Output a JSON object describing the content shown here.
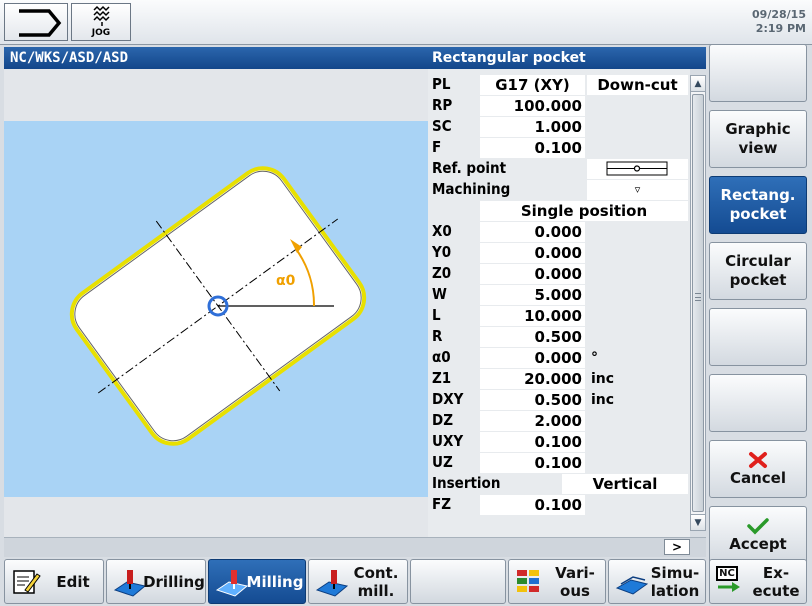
{
  "topbar": {
    "mode_label": "JOG",
    "date": "09/28/15",
    "time": "2:19 PM"
  },
  "path": "NC/WKS/ASD/ASD",
  "dialog_title": "Rectangular pocket",
  "graphic": {
    "angle_label": "α0",
    "colors": {
      "background": "#a9d3f5",
      "pocket_outline": "#e8e000",
      "origin": "#2f6fd8",
      "angle_arc": "#f0a000"
    }
  },
  "params": {
    "pl": {
      "label": "PL",
      "value": "G17 (XY)",
      "option": "Down-cut"
    },
    "rp": {
      "label": "RP",
      "value": "100.000"
    },
    "sc": {
      "label": "SC",
      "value": "1.000"
    },
    "f": {
      "label": "F",
      "value": "0.100"
    },
    "ref_point": {
      "label": "Ref. point"
    },
    "machining": {
      "label": "Machining",
      "value": "▿"
    },
    "position_mode": "Single position",
    "x0": {
      "label": "X0",
      "value": "0.000"
    },
    "y0": {
      "label": "Y0",
      "value": "0.000"
    },
    "z0": {
      "label": "Z0",
      "value": "0.000"
    },
    "w": {
      "label": "W",
      "value": "5.000"
    },
    "l": {
      "label": "L",
      "value": "10.000"
    },
    "r": {
      "label": "R",
      "value": "0.500"
    },
    "a0": {
      "label": "α0",
      "value": "0.000",
      "unit": "°"
    },
    "z1": {
      "label": "Z1",
      "value": "20.000",
      "unit": "inc"
    },
    "dxy": {
      "label": "DXY",
      "value": "0.500",
      "unit": "inc"
    },
    "dz": {
      "label": "DZ",
      "value": "2.000"
    },
    "uxy": {
      "label": "UXY",
      "value": "0.100"
    },
    "uz": {
      "label": "UZ",
      "value": "0.100"
    },
    "insertion": {
      "label": "Insertion",
      "value": "Vertical"
    },
    "fz": {
      "label": "FZ",
      "value": "0.100"
    }
  },
  "next_label": ">",
  "vertical_softkeys": [
    {
      "label": ""
    },
    {
      "label": "Graphic\nview"
    },
    {
      "label": "Rectang.\npocket"
    },
    {
      "label": "Circular\npocket"
    },
    {
      "label": ""
    },
    {
      "label": ""
    },
    {
      "label": "Cancel"
    },
    {
      "label": "Accept"
    }
  ],
  "horizontal_softkeys": [
    {
      "label": "Edit"
    },
    {
      "label": "Drilling"
    },
    {
      "label": "Milling"
    },
    {
      "label": "Cont.\nmill."
    },
    {
      "label": ""
    },
    {
      "label": "Vari-\nous"
    },
    {
      "label": "Simu-\nlation"
    },
    {
      "label": "Ex-\necute",
      "icon_text": "NC"
    }
  ]
}
